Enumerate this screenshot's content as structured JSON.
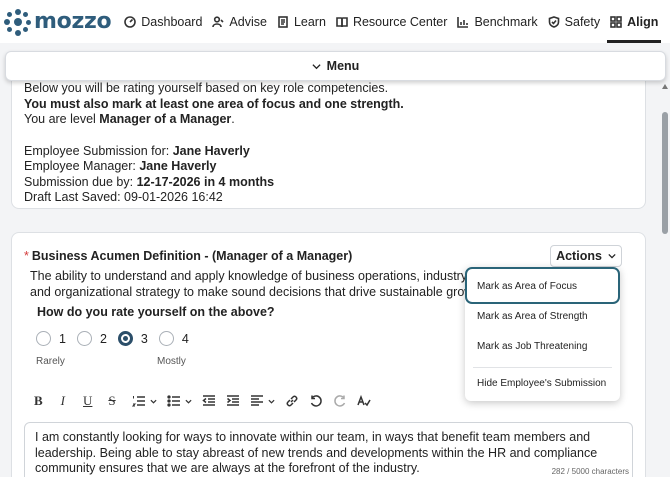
{
  "nav": {
    "logo_text": "mozzo",
    "items": [
      {
        "label": "Dashboard",
        "icon": "dashboard-icon"
      },
      {
        "label": "Advise",
        "icon": "advise-icon"
      },
      {
        "label": "Learn",
        "icon": "learn-icon"
      },
      {
        "label": "Resource Center",
        "icon": "book-icon"
      },
      {
        "label": "Benchmark",
        "icon": "bar-chart-icon"
      },
      {
        "label": "Safety",
        "icon": "shield-icon"
      },
      {
        "label": "Align",
        "icon": "grid-icon",
        "active": true
      }
    ],
    "more": "···"
  },
  "menu": {
    "label": "Menu"
  },
  "intro": {
    "cut_line": "Below you will be rating yourself based on key role competencies.",
    "must_mark": "You must also mark at least one area of focus and one strength.",
    "level_prefix": "You are level ",
    "level_value": "Manager of a Manager",
    "level_suffix": ".",
    "submission_for_label": "Employee Submission for: ",
    "submission_for_value": "Jane Haverly",
    "manager_label": "Employee Manager: ",
    "manager_value": "Jane Haverly",
    "due_label": "Submission due by: ",
    "due_value": "12-17-2026 in 4 months",
    "draft_saved": "Draft Last Saved: 09-01-2026 16:42"
  },
  "competency": {
    "required_mark": "*",
    "title": "Business Acumen Definition - (Manager of a Manager)",
    "actions_label": "Actions",
    "description_line1": "The ability to understand and apply knowledge of business operations, industry trends",
    "description_line2": "and organizational strategy to make sound decisions that drive sustainable growth",
    "rate_question": "How do you rate yourself on the above?",
    "options": [
      "1",
      "2",
      "3",
      "4"
    ],
    "selected": "3",
    "scale_low": "Rarely",
    "scale_high": "Mostly",
    "response": "I am constantly looking for ways to innovate within our team, in ways that benefit team members and leadership. Being able to stay abreast of new trends and developments within the HR and compliance community ensures that we are always at the forefront of the industry.",
    "char_count": "282 / 5000 characters"
  },
  "toolbar": {
    "bold": "B",
    "italic": "I",
    "underline": "U",
    "strike": "S"
  },
  "actions_menu": {
    "items": [
      "Mark as Area of Focus",
      "Mark as Area of Strength",
      "Mark as Job Threatening",
      "Hide Employee's Submission"
    ]
  },
  "colors": {
    "brand": "#2f5d7c",
    "focus_ring": "#2a6478",
    "required": "#d43a3a",
    "radio_selected": "#2b4e69"
  }
}
